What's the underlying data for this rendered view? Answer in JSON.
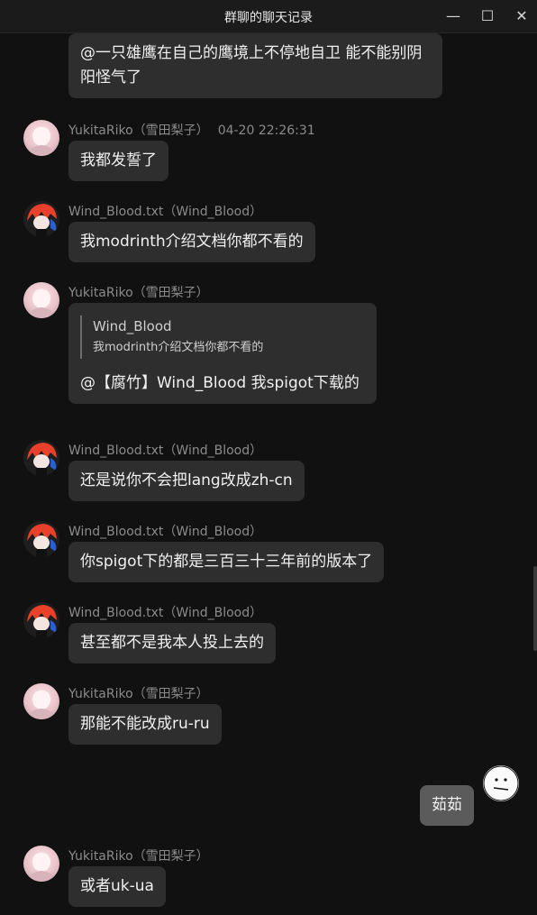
{
  "window": {
    "title": "群聊的聊天记录",
    "minimize": "—",
    "maximize": "☐",
    "close": "✕"
  },
  "messages": [
    {
      "text": "@一只雄鹰在自己的鹰境上不停地自卫 能不能别阴阳怪气了"
    },
    {
      "sender": "YukitaRiko（雪田梨子）",
      "time": "04-20 22:26:31",
      "text": "我都发誓了"
    },
    {
      "sender": "Wind_Blood.txt（Wind_Blood）",
      "text": "我modrinth介绍文档你都不看的"
    },
    {
      "sender": "YukitaRiko（雪田梨子）",
      "quote_name": "Wind_Blood",
      "quote_text": "我modrinth介绍文档你都不看的",
      "text": "@【腐竹】Wind_Blood 我spigot下载的"
    },
    {
      "sender": "Wind_Blood.txt（Wind_Blood）",
      "text": "还是说你不会把lang改成zh-cn"
    },
    {
      "sender": "Wind_Blood.txt（Wind_Blood）",
      "text": "你spigot下的都是三百三十三年前的版本了"
    },
    {
      "sender": "Wind_Blood.txt（Wind_Blood）",
      "text": "甚至都不是我本人投上去的"
    },
    {
      "sender": "YukitaRiko（雪田梨子）",
      "text": "那能不能改成ru-ru"
    },
    {
      "text": "茹茹"
    },
    {
      "sender": "YukitaRiko（雪田梨子）",
      "text": "或者uk-ua"
    }
  ]
}
